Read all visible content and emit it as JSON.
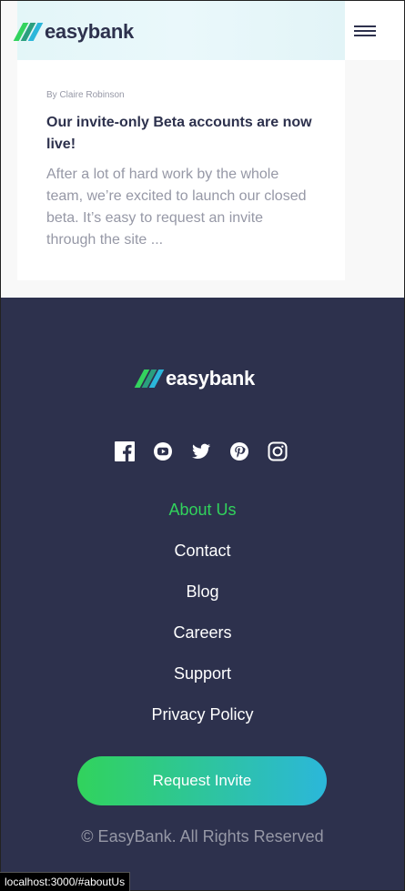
{
  "brand": {
    "name": "easybank",
    "logo_colors": [
      "#33d35e",
      "#2a9f7e",
      "#2bb7da"
    ]
  },
  "header": {
    "menu_icon": "hamburger-menu-icon"
  },
  "article": {
    "author": "By Claire Robinson",
    "title": "Our invite-only Beta accounts are now live!",
    "excerpt": "After a lot of hard work by the whole team, we’re excited to launch our closed beta. It’s easy to request an invite through the site ..."
  },
  "footer": {
    "socials": [
      "facebook-icon",
      "youtube-icon",
      "twitter-icon",
      "pinterest-icon",
      "instagram-icon"
    ],
    "links": [
      "About Us",
      "Contact",
      "Blog",
      "Careers",
      "Support",
      "Privacy Policy"
    ],
    "active_link": "About Us",
    "cta_label": "Request Invite",
    "copyright": "© EasyBank. All Rights Reserved"
  },
  "status_bar": {
    "url": "localhost:3000/#aboutUs"
  },
  "colors": {
    "dark_blue": "#2d314d",
    "lime_green": "#31d35c",
    "bright_cyan": "#2bb7da",
    "grayish_blue": "#9698a6",
    "white": "#ffffff"
  }
}
